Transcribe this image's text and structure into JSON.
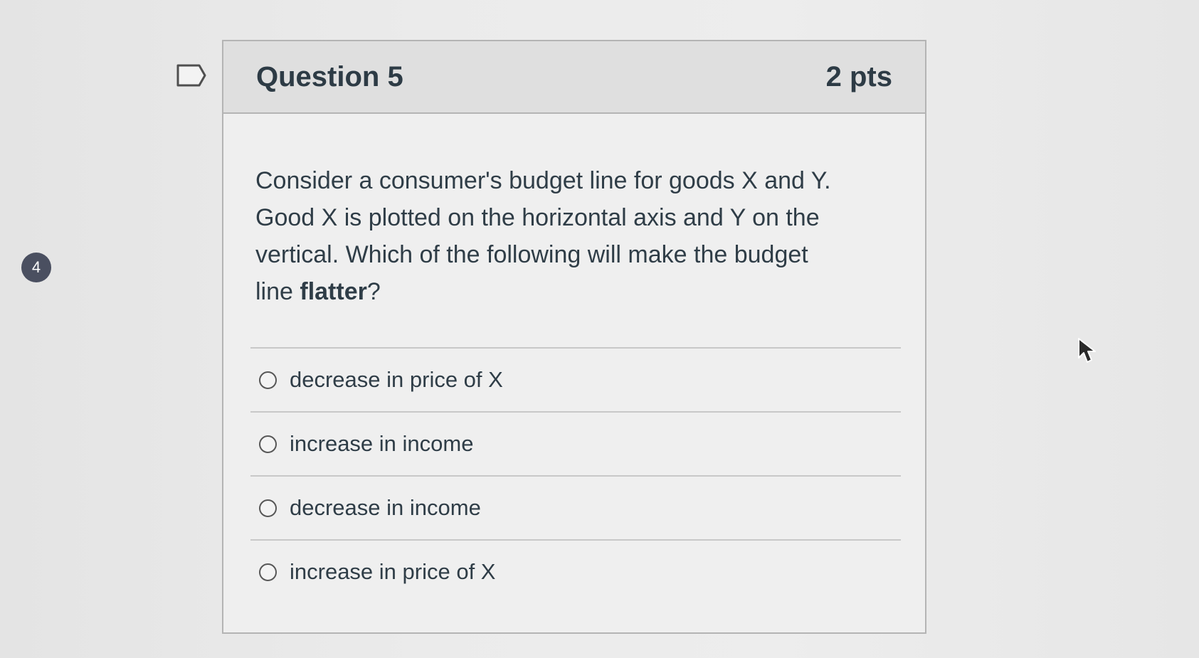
{
  "question": {
    "title": "Question 5",
    "points": "2 pts",
    "text_before_bold": "Consider a consumer's budget line for goods X and Y. Good X is plotted on the horizontal axis and Y on the vertical. Which of the following will make the budget line ",
    "text_bold": "flatter",
    "text_after_bold": "?"
  },
  "navigation": {
    "question_number_badge": "4"
  },
  "answers": [
    {
      "label": "decrease in price of X"
    },
    {
      "label": "increase in income"
    },
    {
      "label": "decrease in income"
    },
    {
      "label": "increase in price of X"
    }
  ],
  "icons": {
    "flag": "flag-outline-icon",
    "cursor": "mouse-pointer-icon"
  },
  "colors": {
    "background": "#e9e9e9",
    "header_background": "#dfdfdf",
    "border": "#b4b4b4",
    "text": "#2d3b45",
    "badge": "#4a4f60"
  }
}
